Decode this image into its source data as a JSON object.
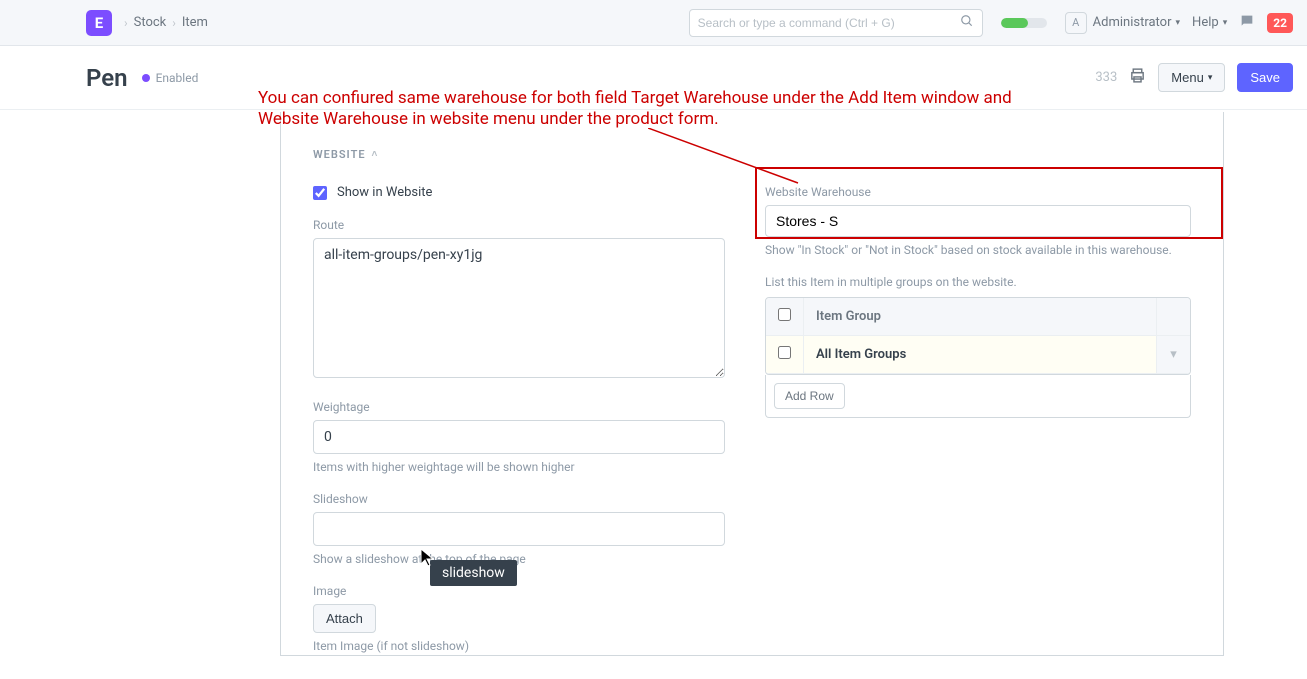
{
  "nav": {
    "logo_letter": "E",
    "breadcrumbs": [
      "Stock",
      "Item"
    ],
    "search_placeholder": "Search or type a command (Ctrl + G)",
    "user_initial": "A",
    "user_label": "Administrator",
    "help_label": "Help",
    "notif_count": "22"
  },
  "header": {
    "title": "Pen",
    "status_label": "Enabled",
    "count": "333",
    "menu_label": "Menu",
    "save_label": "Save"
  },
  "annotation": {
    "line1": "You can confiured same warehouse for both field Target Warehouse under the Add Item window and",
    "line2": "Website Warehouse in website menu  under the product form."
  },
  "section": {
    "title": "WEBSITE"
  },
  "left": {
    "show_in_website_label": "Show in Website",
    "show_in_website_checked": true,
    "route_label": "Route",
    "route_value": "all-item-groups/pen-xy1jg",
    "weightage_label": "Weightage",
    "weightage_value": "0",
    "weightage_help": "Items with higher weightage will be shown higher",
    "slideshow_label": "Slideshow",
    "slideshow_value": "",
    "slideshow_help": "Show a slideshow at the top of the page",
    "image_label": "Image",
    "attach_label": "Attach",
    "image_help": "Item Image (if not slideshow)"
  },
  "right": {
    "ww_label": "Website Warehouse",
    "ww_value": "Stores - S",
    "ww_help": "Show \"In Stock\" or \"Not in Stock\" based on stock available in this warehouse.",
    "groups_help": "List this Item in multiple groups on the website.",
    "table_header": "Item Group",
    "rows": [
      {
        "label": "All Item Groups"
      }
    ],
    "addrow_label": "Add Row"
  },
  "tooltip": "slideshow"
}
